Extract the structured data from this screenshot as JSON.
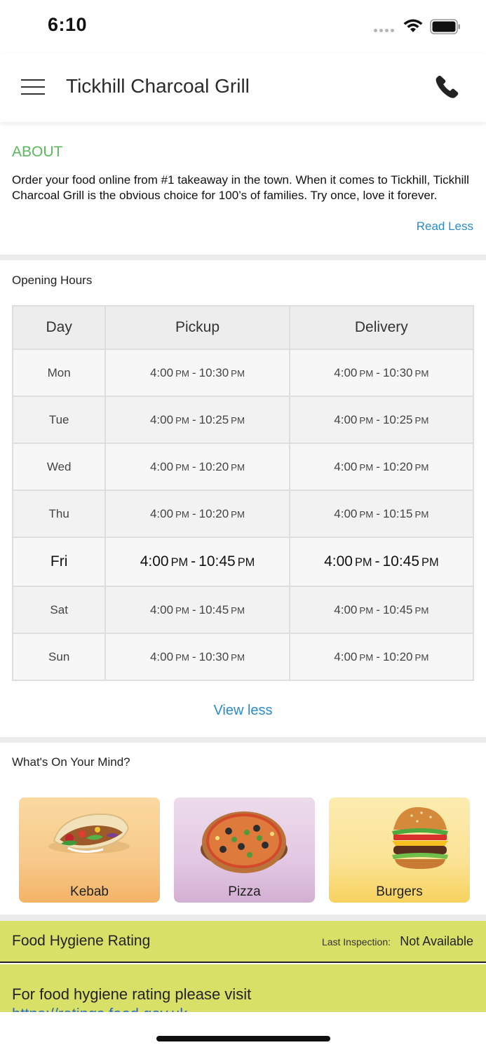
{
  "status_bar": {
    "time": "6:10"
  },
  "header": {
    "title": "Tickhill Charcoal Grill"
  },
  "about": {
    "title": "ABOUT",
    "text": "Order your food online from #1 takeaway in the town. When it comes to Tickhill, Tickhill Charcoal Grill is the obvious choice for 100’s of families. Try once, love it forever.",
    "read_less": "Read Less"
  },
  "hours": {
    "title": "Opening Hours",
    "columns": [
      "Day",
      "Pickup",
      "Delivery"
    ],
    "rows": [
      {
        "day": "Mon",
        "pickup": {
          "open": "4:00",
          "open_ap": "PM",
          "close": "10:30",
          "close_ap": "PM"
        },
        "delivery": {
          "open": "4:00",
          "open_ap": "PM",
          "close": "10:30",
          "close_ap": "PM"
        }
      },
      {
        "day": "Tue",
        "pickup": {
          "open": "4:00",
          "open_ap": "PM",
          "close": "10:25",
          "close_ap": "PM"
        },
        "delivery": {
          "open": "4:00",
          "open_ap": "PM",
          "close": "10:25",
          "close_ap": "PM"
        }
      },
      {
        "day": "Wed",
        "pickup": {
          "open": "4:00",
          "open_ap": "PM",
          "close": "10:20",
          "close_ap": "PM"
        },
        "delivery": {
          "open": "4:00",
          "open_ap": "PM",
          "close": "10:20",
          "close_ap": "PM"
        }
      },
      {
        "day": "Thu",
        "pickup": {
          "open": "4:00",
          "open_ap": "PM",
          "close": "10:20",
          "close_ap": "PM"
        },
        "delivery": {
          "open": "4:00",
          "open_ap": "PM",
          "close": "10:15",
          "close_ap": "PM"
        }
      },
      {
        "day": "Fri",
        "pickup": {
          "open": "4:00",
          "open_ap": "PM",
          "close": "10:45",
          "close_ap": "PM"
        },
        "delivery": {
          "open": "4:00",
          "open_ap": "PM",
          "close": "10:45",
          "close_ap": "PM"
        }
      },
      {
        "day": "Sat",
        "pickup": {
          "open": "4:00",
          "open_ap": "PM",
          "close": "10:45",
          "close_ap": "PM"
        },
        "delivery": {
          "open": "4:00",
          "open_ap": "PM",
          "close": "10:45",
          "close_ap": "PM"
        }
      },
      {
        "day": "Sun",
        "pickup": {
          "open": "4:00",
          "open_ap": "PM",
          "close": "10:30",
          "close_ap": "PM"
        },
        "delivery": {
          "open": "4:00",
          "open_ap": "PM",
          "close": "10:20",
          "close_ap": "PM"
        }
      }
    ],
    "highlighted_day": "Fri",
    "separator": "-",
    "view_less": "View less"
  },
  "mind": {
    "title": "What's On Your Mind?",
    "categories": [
      {
        "label": "Kebab",
        "icon": "kebab-image"
      },
      {
        "label": "Pizza",
        "icon": "pizza-image"
      },
      {
        "label": "Burgers",
        "icon": "burger-image"
      }
    ]
  },
  "hygiene": {
    "title": "Food Hygiene Rating",
    "last_inspection_label": "Last Inspection:",
    "last_inspection_value": "Not Available",
    "text": "For food hygiene rating please visit",
    "link": "https://ratings.food.gov.uk"
  },
  "colors": {
    "accent_green": "#5cb85c",
    "link_blue": "#2a8cc7",
    "hygiene_bg": "#d8e068"
  }
}
